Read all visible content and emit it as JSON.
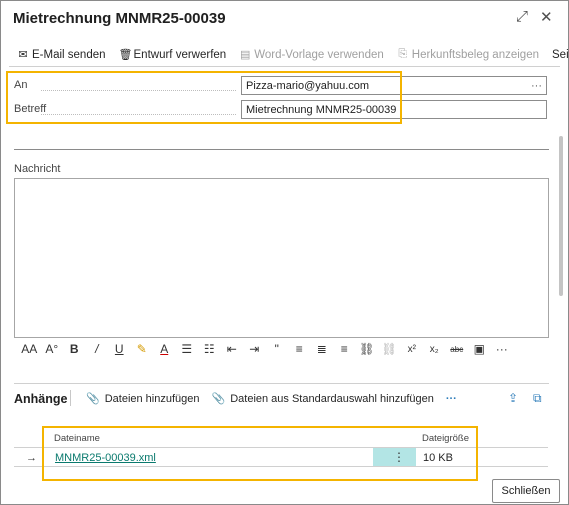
{
  "window": {
    "title": "Mietrechnung MNMR25-00039",
    "expand_glyph": "⤢",
    "close_glyph": "✕"
  },
  "toolbar": {
    "send_email": "E-Mail senden",
    "discard_draft": "Entwurf verwerfen",
    "use_word_template": "Word-Vorlage verwenden",
    "show_source_doc": "Herkunftsbeleg anzeigen",
    "page": "Seite"
  },
  "fields": {
    "to_label": "An",
    "to_value": "Pizza-mario@yahuu.com",
    "to_more": "···",
    "subject_label": "Betreff",
    "subject_value": "Mietrechnung MNMR25-00039"
  },
  "message": {
    "label": "Nachricht",
    "body": ""
  },
  "format_toolbar": [
    "AA",
    "A°",
    "B",
    "/",
    "U",
    "✎",
    "A",
    "☰",
    "☷",
    "⇤",
    "⇥",
    "\"",
    "≡",
    "≣",
    "≡",
    "⛓",
    "⛓",
    "x²",
    "x₂",
    "abc",
    "▣",
    "···"
  ],
  "attachments": {
    "title": "Anhänge",
    "add_files": "Dateien hinzufügen",
    "add_from_default": "Dateien aus Standardauswahl hinzufügen",
    "more": "···",
    "columns": {
      "name": "Dateiname",
      "size": "Dateigröße"
    },
    "rows": [
      {
        "name": "MNMR25-00039.xml",
        "size": "10 KB"
      }
    ]
  },
  "footer": {
    "close_label": "Schließen"
  },
  "colors": {
    "highlight": "#f4b400",
    "link": "#0a7a6e",
    "selected_cell": "#b3e5e5"
  }
}
